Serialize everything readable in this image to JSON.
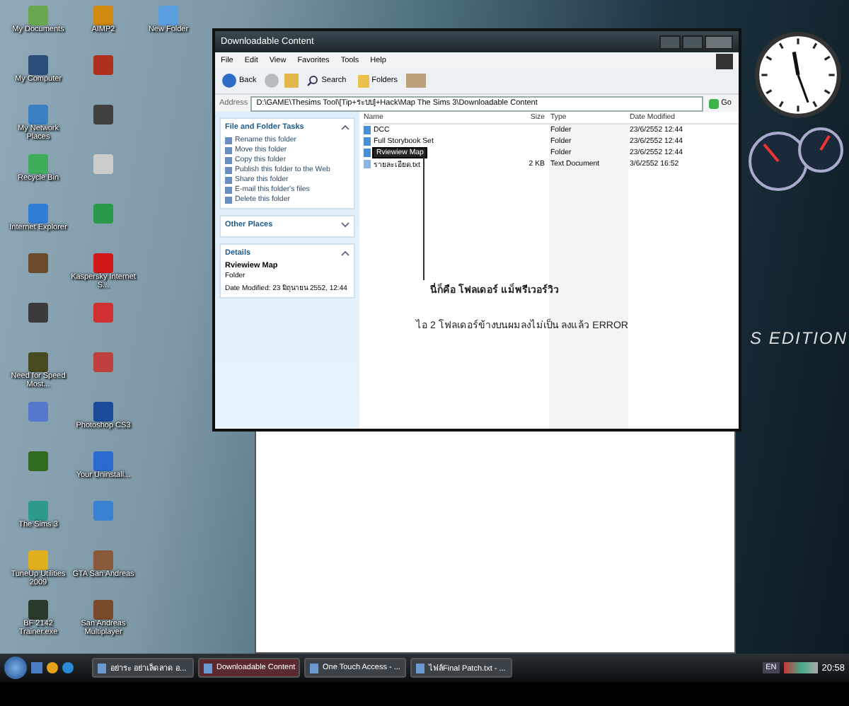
{
  "desktop_icons": [
    {
      "label": "My Documents",
      "color": "#6aa84f"
    },
    {
      "label": "My Computer",
      "color": "#2a4d7a"
    },
    {
      "label": "My Network Places",
      "color": "#3a7fc4"
    },
    {
      "label": "Recycle Bin",
      "color": "#3fae5a"
    },
    {
      "label": "Internet Explorer",
      "color": "#2f7fd8"
    },
    {
      "color": "#6b4a2a"
    },
    {
      "color": "#3a3a3a"
    },
    {
      "label": "Need for Speed Most...",
      "color": "#4a4a20"
    },
    {
      "color": "#5577cc"
    },
    {
      "color": "#2f6a1f"
    },
    {
      "label": "The Sims 3",
      "color": "#2e9a8a"
    },
    {
      "label": "TuneUp Utilities 2009",
      "color": "#e0b020"
    },
    {
      "label": "BF 2142 Trainer.exe",
      "color": "#2a3a2a"
    },
    {
      "label": "AIMP2",
      "color": "#d08a10"
    },
    {
      "color": "#b03020"
    },
    {
      "color": "#404040"
    },
    {
      "color": "#cccccc"
    },
    {
      "color": "#2a9a4a"
    },
    {
      "label": "Kaspersky Internet S...",
      "color": "#d01818"
    },
    {
      "color": "#d03030"
    },
    {
      "color": "#c04040"
    },
    {
      "label": "Photoshop CS3",
      "color": "#1a4a9a"
    },
    {
      "label": "Your Uninstall...",
      "color": "#2a6ad0"
    },
    {
      "color": "#3a80d0"
    },
    {
      "label": "GTA San Andreas",
      "color": "#8a5a3a"
    },
    {
      "label": "San Andreas Multiplayer",
      "color": "#7a4a2a"
    },
    {
      "label": "New Folder",
      "color": "#5aa0e0"
    }
  ],
  "window": {
    "title": "Downloadable Content",
    "menu": [
      "File",
      "Edit",
      "View",
      "Favorites",
      "Tools",
      "Help"
    ],
    "toolbar": {
      "back": "Back",
      "search": "Search",
      "folders": "Folders"
    },
    "address": {
      "label": "Address",
      "value": "D:\\GAME\\Thesims Tool\\[Tip+ระบบ]+Hack\\Map The Sims 3\\Downloadable Content",
      "go": "Go"
    },
    "tasks_panel": {
      "title": "File and Folder Tasks",
      "expanded": true,
      "items": [
        "Rename this folder",
        "Move this folder",
        "Copy this folder",
        "Publish this folder to the Web",
        "Share this folder",
        "E-mail this folder's files",
        "Delete this folder"
      ]
    },
    "other_places": {
      "title": "Other Places",
      "expanded": false
    },
    "details": {
      "title": "Details",
      "expanded": true,
      "name": "Rviewiew Map",
      "type": "Folder",
      "date": "Date Modified: 23 มิถุนายน 2552, 12:44"
    },
    "columns": [
      "Name",
      "Size",
      "Type",
      "Date Modified"
    ],
    "rows": [
      {
        "kind": "folder",
        "name": "DCC",
        "size": "",
        "type": "Folder",
        "date": "23/6/2552 12:44",
        "selected": false
      },
      {
        "kind": "folder",
        "name": "Full Storybook Set",
        "size": "",
        "type": "Folder",
        "date": "23/6/2552 12:44",
        "selected": false
      },
      {
        "kind": "folder",
        "name": "Rviewiew Map",
        "size": "",
        "type": "Folder",
        "date": "23/6/2552 12:44",
        "selected": true
      },
      {
        "kind": "text",
        "name": "รายละเอียด.txt",
        "size": "2 KB",
        "type": "Text Document",
        "date": "3/6/2552 16:52",
        "selected": false
      }
    ],
    "annotations": [
      "นี่ก็คือ โฟลเดอร์ แม็พรีเวอร์วิว",
      "ไอ 2 โฟลเดอร์ข้างบนผมลงไม่เป็น ลงแล้ว ERROR"
    ]
  },
  "wallpaper_text": "S EDITION",
  "taskbar": {
    "tasks": [
      {
        "label": "อย่าระ อย่าเล็ดลาด อ...",
        "selected": false
      },
      {
        "label": "Downloadable Content",
        "selected": true
      },
      {
        "label": "One Touch Access - ...",
        "selected": false
      },
      {
        "label": "ไฟล์Final Patch.txt - ...",
        "selected": false
      }
    ],
    "language": "EN",
    "time": "20:58"
  }
}
